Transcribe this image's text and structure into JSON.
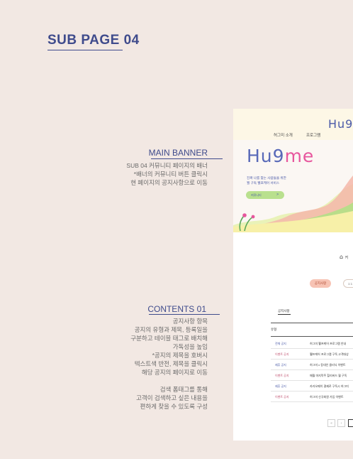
{
  "page_heading": "SUB PAGE 04",
  "sections": {
    "main_banner": {
      "title": "MAIN BANNER",
      "lines": [
        "SUB 04 커뮤니티 페이지의 배너",
        "*배너의 커뮤니티 버튼 클릭시",
        "현 페이지의 공지사항으로 이동"
      ]
    },
    "contents": {
      "title": "CONTENTS 01",
      "lines": [
        "공지사항 항목",
        "공지의 유형과 제목, 등록일을",
        "구분하고 테이블 태그로 배치해",
        "가독성을 높임",
        "*공지의 제목을 호버시",
        "텍스트색 반전, 제목을 클릭시",
        "해당 공지의 페이지로 이동"
      ],
      "lines2": [
        "검색 폼태그를 통해",
        "고객이 검색하고 싶은 내용을",
        "편하게 찾을 수 있도록 구성"
      ]
    }
  },
  "mockup": {
    "header_logo": "Hu9",
    "nav": [
      "허그미 소개",
      "프로그램"
    ],
    "banner": {
      "logo_blue": "Hu9",
      "logo_pink": "me",
      "copy_line1": "진짜 나를 찾는 사람들을 위한",
      "copy_line2": "월 구독 웰프케어 서비스",
      "button_label": "커뮤니티",
      "button_arrow": ">"
    },
    "crumb_icon": "⌂",
    "crumb_text": "커",
    "tabs": {
      "active": "공지사항",
      "other": "1:1"
    },
    "notice_label": "공지사항",
    "table": {
      "header_type": "유형",
      "rows": [
        {
          "type": "전체 공지",
          "title": "허그미 웰프케어 프로그램 안내",
          "color": "#4a5aa8"
        },
        {
          "type": "이벤트 공지",
          "title": "웰프케어 프로그램 구독 고객대상",
          "color": "#c04f6e"
        },
        {
          "type": "제휴 공지",
          "title": "허그미 x 동대인 클리닉 이벤트",
          "color": "#4a5aa8"
        },
        {
          "type": "이벤트 공지",
          "title": "매월 마지막주 힐리버드 월 구독",
          "color": "#c04f6e"
        },
        {
          "type": "제휴 공지",
          "title": "카카오페이 결제로 구독시 허그미",
          "color": "#4a5aa8"
        },
        {
          "type": "이벤트 공지",
          "title": "허그미 신규회원 가입 이벤트",
          "color": "#c04f6e"
        }
      ]
    },
    "pager": [
      "«",
      "‹"
    ]
  }
}
